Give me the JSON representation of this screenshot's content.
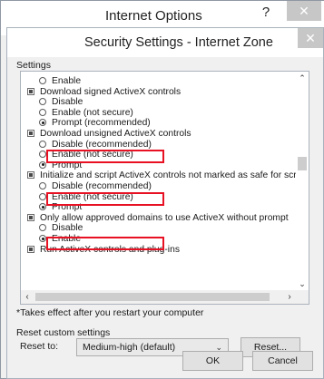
{
  "outer_window": {
    "title": "Internet Options",
    "help": "?",
    "close": "✕"
  },
  "dialog": {
    "title": "Security Settings - Internet Zone",
    "close": "✕"
  },
  "settings_group_label": "Settings",
  "settings": [
    {
      "kind": "radio",
      "checked": false,
      "label": "Enable"
    },
    {
      "kind": "check",
      "label": "Download signed ActiveX controls"
    },
    {
      "kind": "radio",
      "checked": false,
      "label": "Disable"
    },
    {
      "kind": "radio",
      "checked": false,
      "label": "Enable (not secure)"
    },
    {
      "kind": "radio",
      "checked": true,
      "label": "Prompt (recommended)"
    },
    {
      "kind": "check",
      "label": "Download unsigned ActiveX controls"
    },
    {
      "kind": "radio",
      "checked": false,
      "label": "Disable (recommended)"
    },
    {
      "kind": "radio",
      "checked": false,
      "label": "Enable (not secure)"
    },
    {
      "kind": "radio",
      "checked": true,
      "label": "Prompt"
    },
    {
      "kind": "check",
      "label": "Initialize and script ActiveX controls not marked as safe for script"
    },
    {
      "kind": "radio",
      "checked": false,
      "label": "Disable (recommended)"
    },
    {
      "kind": "radio",
      "checked": false,
      "label": "Enable (not secure)"
    },
    {
      "kind": "radio",
      "checked": true,
      "label": "Prompt"
    },
    {
      "kind": "check",
      "label": "Only allow approved domains to use ActiveX without prompt"
    },
    {
      "kind": "radio",
      "checked": false,
      "label": "Disable"
    },
    {
      "kind": "radio",
      "checked": true,
      "label": "Enable"
    },
    {
      "kind": "check",
      "label": "Run ActiveX controls and plug-ins"
    }
  ],
  "highlight_color": "#e81123",
  "note": "*Takes effect after you restart your computer",
  "reset_group_label": "Reset custom settings",
  "reset_to_label": "Reset to:",
  "reset_select_value": "Medium-high (default)",
  "reset_button": "Reset...",
  "ok_button": "OK",
  "cancel_button": "Cancel"
}
